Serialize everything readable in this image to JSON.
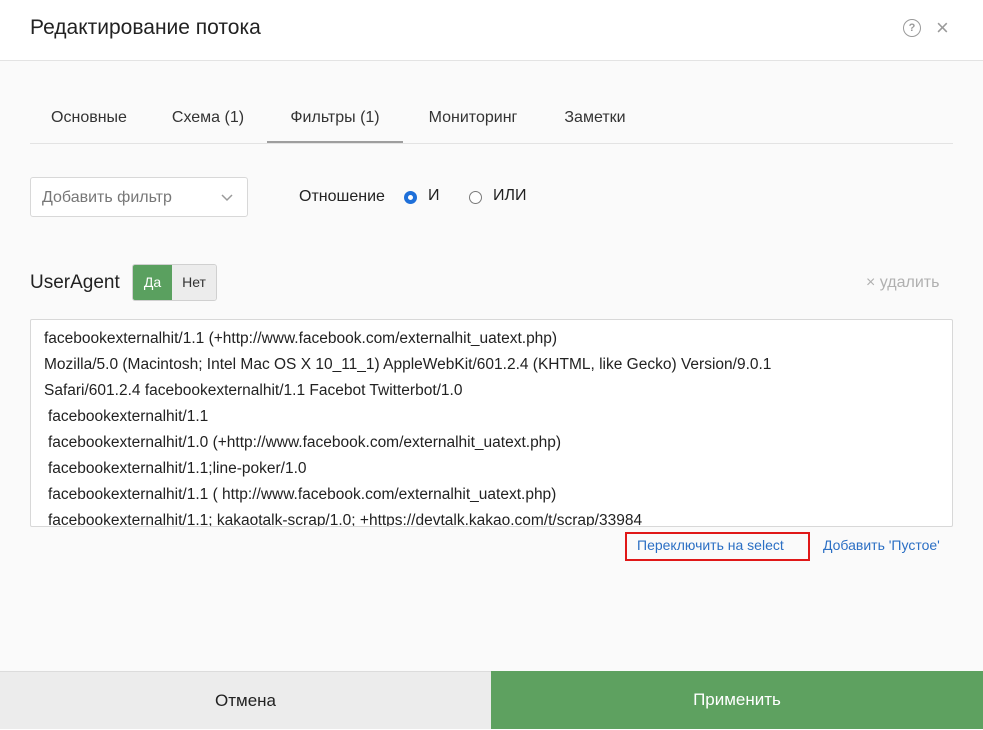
{
  "dialog": {
    "title": "Редактирование потока",
    "help_icon": "question-circle-icon",
    "close_icon": "close-icon",
    "help_glyph": "?",
    "close_glyph": "×"
  },
  "tabs": [
    {
      "label": "Основные",
      "active": false
    },
    {
      "label": "Схема (1)",
      "active": false
    },
    {
      "label": "Фильтры (1)",
      "active": true
    },
    {
      "label": "Мониторинг",
      "active": false
    },
    {
      "label": "Заметки",
      "active": false
    }
  ],
  "filters": {
    "add_filter_placeholder": "Добавить фильтр",
    "relation_label": "Отношение",
    "relation_options": [
      {
        "label": "И",
        "selected": true
      },
      {
        "label": "ИЛИ",
        "selected": false
      }
    ]
  },
  "filter_field": {
    "label": "UserAgent",
    "toggle_yes": "Да",
    "toggle_no": "Нет",
    "toggle_value": "Да",
    "delete_label": "× удалить",
    "values": [
      "facebookexternalhit/1.1 (+http://www.facebook.com/externalhit_uatext.php)",
      "Mozilla/5.0 (Macintosh; Intel Mac OS X 10_11_1) AppleWebKit/601.2.4 (KHTML, like Gecko) Version/9.0.1",
      "Safari/601.2.4 facebookexternalhit/1.1 Facebot Twitterbot/1.0",
      " facebookexternalhit/1.1",
      " facebookexternalhit/1.0 (+http://www.facebook.com/externalhit_uatext.php)",
      " facebookexternalhit/1.1;line-poker/1.0",
      " facebookexternalhit/1.1 ( http://www.facebook.com/externalhit_uatext.php)",
      " facebookexternalhit/1.1; kakaotalk-scrap/1.0; +https://devtalk.kakao.com/t/scrap/33984"
    ],
    "switch_link": "Переключить на select",
    "add_empty_link": "Добавить 'Пустое'"
  },
  "footer": {
    "cancel_label": "Отмена",
    "apply_label": "Применить"
  },
  "colors": {
    "accent_green": "#5ea160",
    "link_blue": "#2b6fc4",
    "radio_blue": "#1e6fd9",
    "highlight_red": "#e01818"
  }
}
